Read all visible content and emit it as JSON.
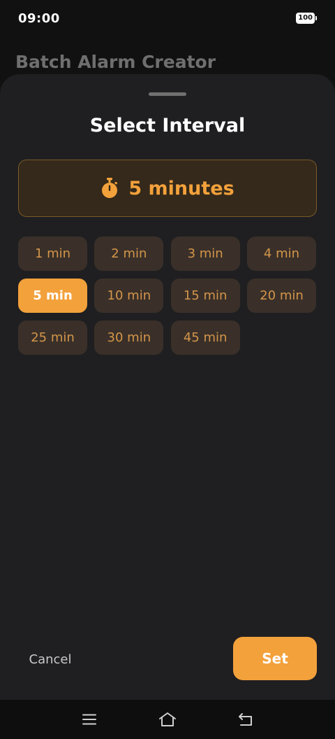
{
  "status_bar": {
    "time": "09:00",
    "battery": "100"
  },
  "app": {
    "title": "Batch Alarm Creator"
  },
  "sheet": {
    "title": "Select Interval",
    "selected_label": "5 minutes",
    "selected_icon": "stopwatch-icon",
    "options": [
      {
        "label": "1 min"
      },
      {
        "label": "2 min"
      },
      {
        "label": "3 min"
      },
      {
        "label": "4 min"
      },
      {
        "label": "5 min",
        "selected": true
      },
      {
        "label": "10 min"
      },
      {
        "label": "15 min"
      },
      {
        "label": "20 min"
      },
      {
        "label": "25 min"
      },
      {
        "label": "30 min"
      },
      {
        "label": "45 min"
      }
    ],
    "cancel_label": "Cancel",
    "set_label": "Set"
  },
  "nav": {
    "icons": [
      "menu-icon",
      "home-icon",
      "back-icon"
    ]
  },
  "colors": {
    "accent": "#f3a13b",
    "sheet_bg": "#1f1f21",
    "chip_bg": "#3a3029",
    "chip_text": "#d4954a"
  }
}
